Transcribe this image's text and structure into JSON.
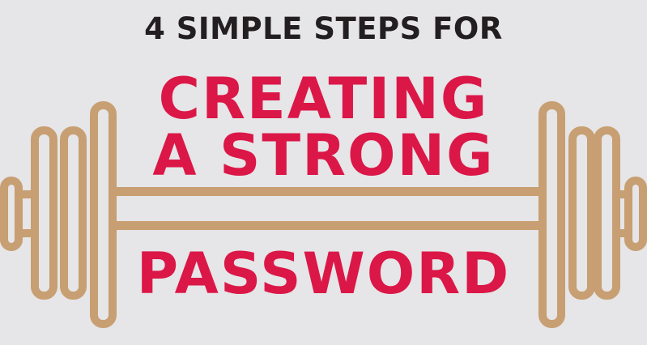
{
  "heading": {
    "subtitle": "4 SIMPLE STEPS FOR",
    "line1": "CREATING",
    "line2": "A STRONG",
    "line3": "PASSWORD"
  },
  "colors": {
    "background": "#e6e5e7",
    "barbell": "#c79f72",
    "subtitle_text": "#231f20",
    "title_text": "#db1748"
  },
  "icons": [
    "barbell-icon"
  ]
}
